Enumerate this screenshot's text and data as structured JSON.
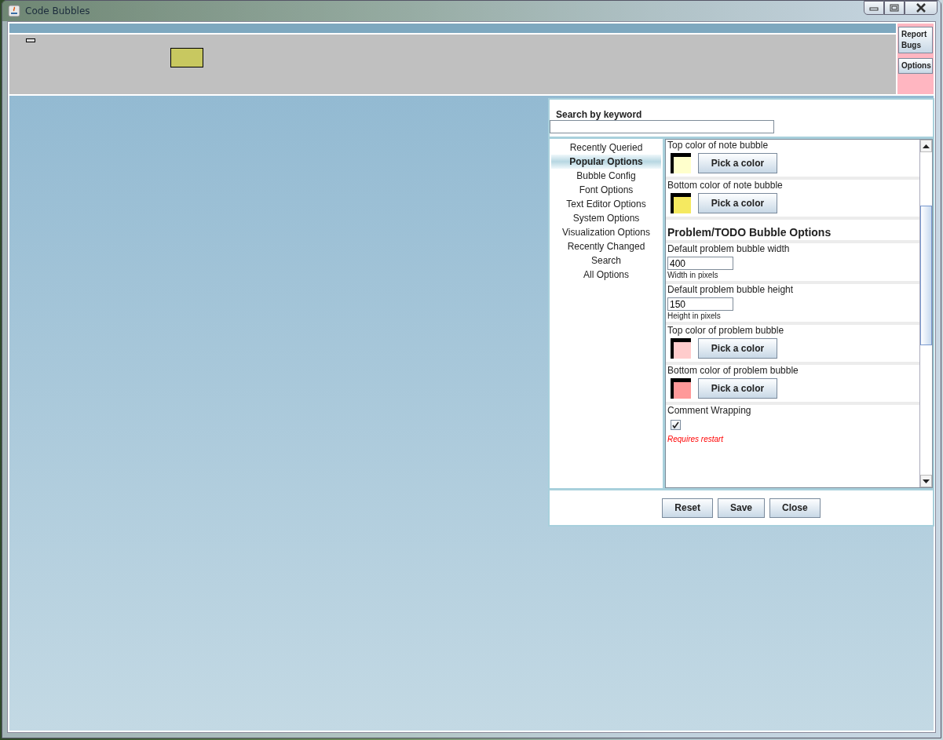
{
  "window": {
    "title": "Code Bubbles"
  },
  "side_buttons": [
    {
      "label": "Report Bugs"
    },
    {
      "label": "Options"
    }
  ],
  "options_dialog": {
    "search": {
      "label": "Search by keyword"
    },
    "categories": [
      {
        "label": "Recently Queried",
        "selected": false
      },
      {
        "label": "Popular Options",
        "selected": true
      },
      {
        "label": "Bubble Config",
        "selected": false
      },
      {
        "label": "Font Options",
        "selected": false
      },
      {
        "label": "Text Editor Options",
        "selected": false
      },
      {
        "label": "System Options",
        "selected": false
      },
      {
        "label": "Visualization Options",
        "selected": false
      },
      {
        "label": "Recently Changed",
        "selected": false
      },
      {
        "label": "Search",
        "selected": false
      },
      {
        "label": "All Options",
        "selected": false
      }
    ],
    "settings": [
      {
        "kind": "color",
        "label": "Top color of note bubble",
        "color": "#ffffcc",
        "button": "Pick a color"
      },
      {
        "kind": "color",
        "label": "Bottom color of note bubble",
        "color": "#f5e960",
        "button": "Pick a color"
      },
      {
        "kind": "heading",
        "label": "Problem/TODO Bubble Options"
      },
      {
        "kind": "number",
        "label": "Default problem bubble width",
        "value": "400",
        "hint": "Width in pixels"
      },
      {
        "kind": "number",
        "label": "Default problem bubble height",
        "value": "150",
        "hint": "Height in pixels"
      },
      {
        "kind": "color",
        "label": "Top color of problem bubble",
        "color": "#ffcccc",
        "button": "Pick a color"
      },
      {
        "kind": "color",
        "label": "Bottom color of problem bubble",
        "color": "#ff9999",
        "button": "Pick a color"
      },
      {
        "kind": "checkbox",
        "label": "Comment Wrapping",
        "checked": true,
        "note": "Requires restart"
      }
    ],
    "buttons": [
      {
        "label": "Reset"
      },
      {
        "label": "Save"
      },
      {
        "label": "Close"
      }
    ]
  }
}
